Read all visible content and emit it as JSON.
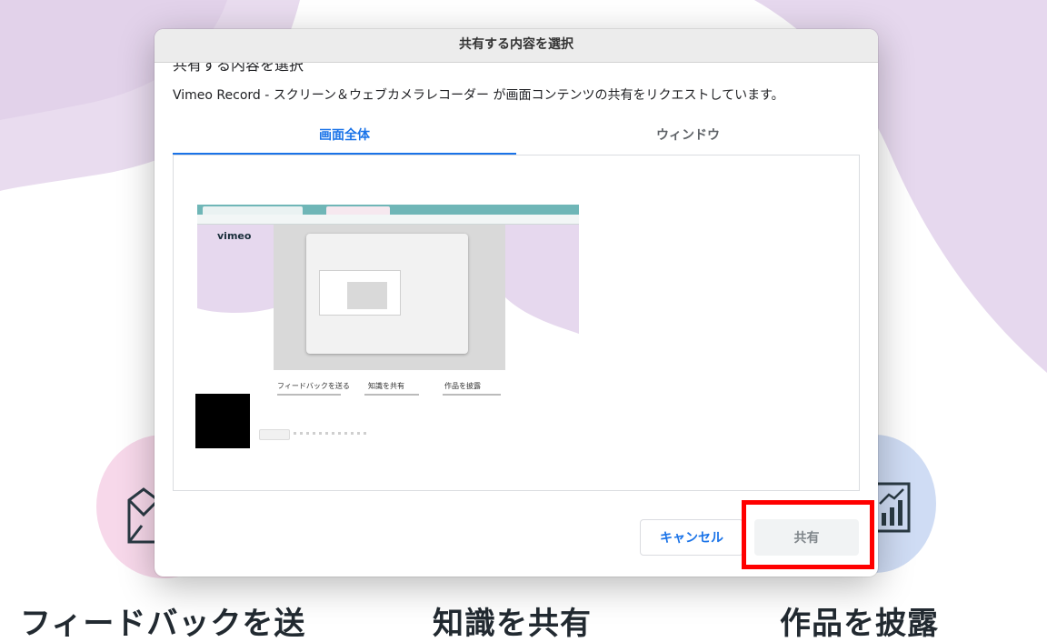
{
  "background": {
    "features": [
      {
        "title": "フィードバックを送"
      },
      {
        "title": "知識を共有"
      },
      {
        "title": "作品を披露"
      }
    ],
    "colors": {
      "wave": "#e6d8ee",
      "circle_left": "#f7d8ea",
      "circle_right": "#cfdcf4",
      "title_text": "#222a31"
    },
    "icons": [
      "mail-icon",
      "chart-icon"
    ]
  },
  "dialog": {
    "title": "共有する内容を選択",
    "heading_partial": "共有する内容を選択",
    "request_message": "Vimeo Record - スクリーン＆ウェブカメラレコーダー が画面コンテンツの共有をリクエストしています。",
    "tabs": [
      {
        "label": "画面全体",
        "active": true
      },
      {
        "label": "ウィンドウ",
        "active": false
      }
    ],
    "preview": {
      "logo": "vimeo",
      "features": [
        "フィードバックを送る",
        "知識を共有",
        "作品を披露"
      ]
    },
    "buttons": {
      "cancel": "キャンセル",
      "share": "共有"
    },
    "colors": {
      "accent": "#1a73e8",
      "share_disabled_bg": "#f1f3f4",
      "highlight": "#ff0000"
    }
  }
}
